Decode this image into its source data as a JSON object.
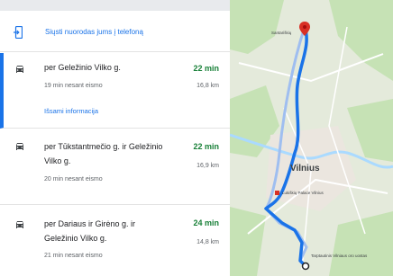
{
  "send": {
    "label": "Siųsti nuorodas jums į telefoną",
    "icon": "send-to-phone-icon"
  },
  "routes": [
    {
      "title": "per Geležinio Vilko g.",
      "time": "22 min",
      "sub": "19 min nesant eismo",
      "distance": "16,8 km",
      "details": "Išsami informacija",
      "selected": true
    },
    {
      "title": "per Tūkstantmečio g. ir Geležinio Vilko g.",
      "time": "22 min",
      "sub": "20 min nesant eismo",
      "distance": "16,9 km"
    },
    {
      "title": "per Dariaus ir Girėno g. ir Geležinio Vilko g.",
      "time": "24 min",
      "sub": "21 min nesant eismo",
      "distance": "14,8 km"
    }
  ],
  "map": {
    "city_label": "Vilnius",
    "start_label": "Santariškių",
    "end_label": "Tarptautinis Vilniaus oro uostas",
    "poi_label": "Lukiškių Palace Vilnius",
    "colors": {
      "route": "#1a73e8",
      "alt_route": "#9fbef0",
      "land": "#e4eadb",
      "forest": "#c6e2b5",
      "water": "#aadaff",
      "road": "#ffffff",
      "marker": "#d93025"
    }
  }
}
